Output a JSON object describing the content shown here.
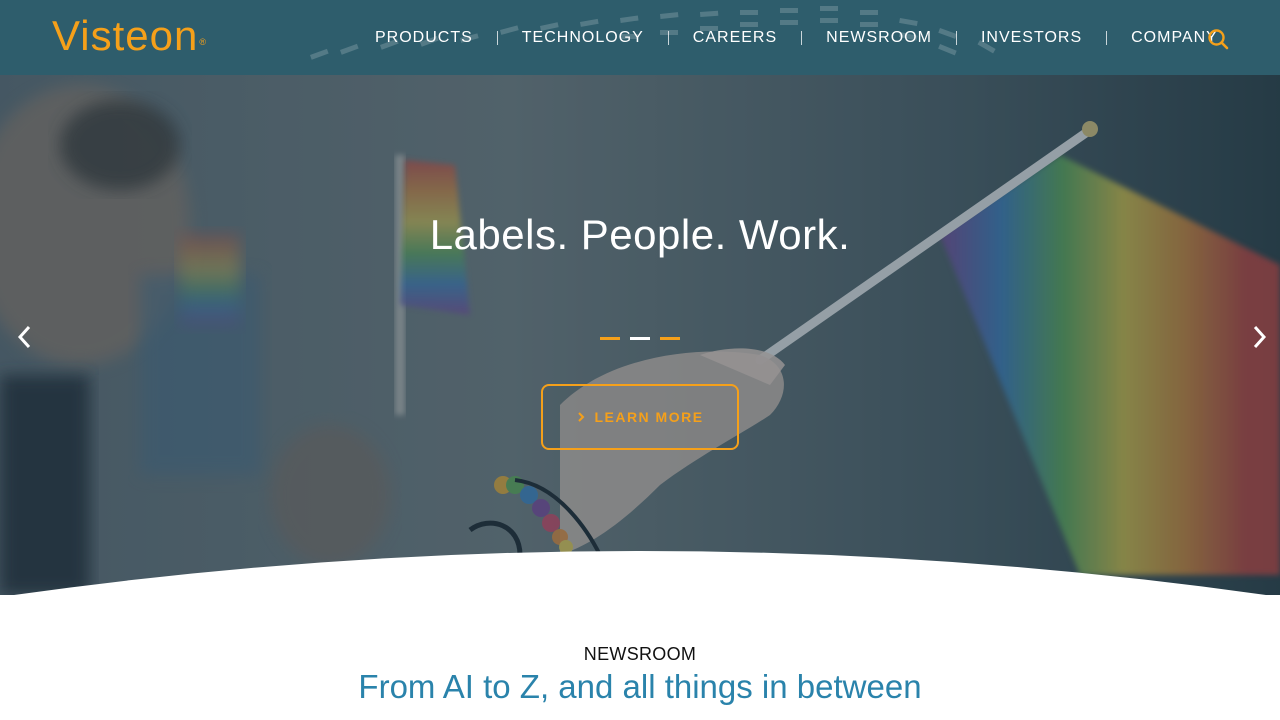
{
  "brand": {
    "logo_text": "Visteon",
    "accent": "#f5a01a",
    "header_bg": "#2e5d6c",
    "headline_color": "#2a83ab"
  },
  "nav": {
    "items": [
      "PRODUCTS",
      "TECHNOLOGY",
      "CAREERS",
      "NEWSROOM",
      "INVESTORS",
      "COMPANY"
    ],
    "search_icon": "search-icon"
  },
  "hero": {
    "title": "Labels. People. Work.",
    "cta_label": "LEARN MORE",
    "cta_icon": "chevron-right-icon",
    "slides": 3,
    "active_slide": 2,
    "prev_icon": "chevron-left-icon",
    "next_icon": "chevron-right-icon"
  },
  "newsroom": {
    "label": "NEWSROOM",
    "headline": "From AI to Z, and all things in between"
  }
}
